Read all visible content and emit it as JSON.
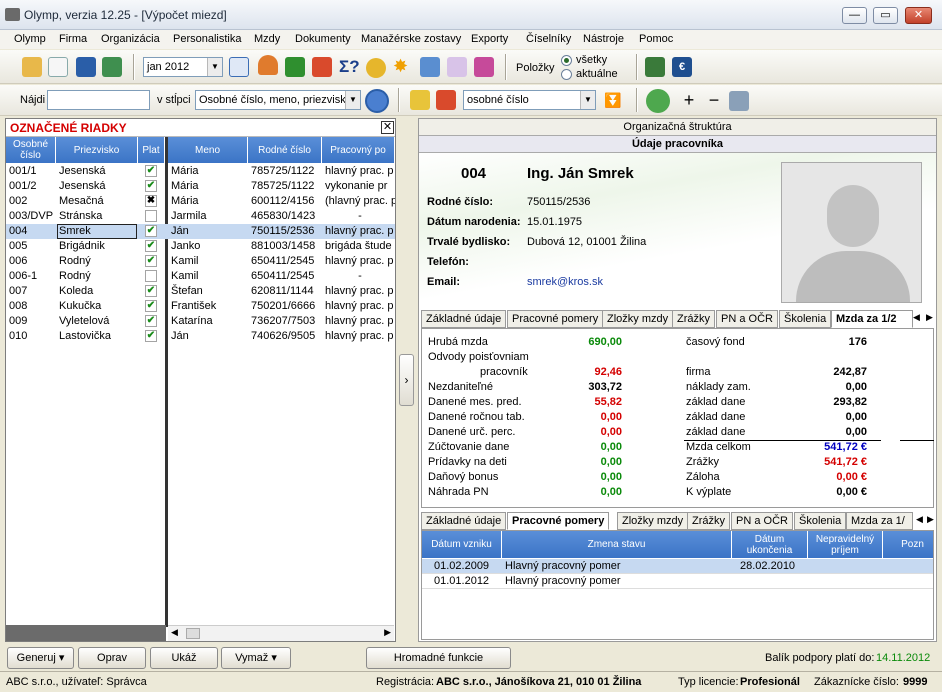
{
  "window": {
    "title": "Olymp, verzia 12.25 - [Výpočet miezd]"
  },
  "menu": [
    "Olymp",
    "Firma",
    "Organizácia",
    "Personalistika",
    "Mzdy",
    "Dokumenty",
    "Manažérske zostavy",
    "Exporty",
    "Číselníky",
    "Nástroje",
    "Pomoc"
  ],
  "toolbar": {
    "period": "jan 2012",
    "polozky_label": "Položky",
    "radio_all": "všetky",
    "radio_current": "aktuálne"
  },
  "search": {
    "label": "Nájdi",
    "in_column_label": "v stĺpci",
    "column_value": "Osobné číslo, meno, priezvisk",
    "sort_value": "osobné číslo"
  },
  "left": {
    "title": "OZNAČENÉ RIADKY",
    "headers": [
      "Osobné číslo",
      "Priezvisko",
      "Plat",
      "Meno",
      "Rodné číslo",
      "Pracovný po"
    ],
    "rows": [
      {
        "id": "001/1",
        "surname": "Jesenská",
        "chk": "✔",
        "name": "Mária",
        "rc": "785725/1122",
        "job": "hlavný prac. p"
      },
      {
        "id": "001/2",
        "surname": "Jesenská",
        "chk": "✔",
        "name": "Mária",
        "rc": "785725/1122",
        "job": "vykonanie pr"
      },
      {
        "id": "002",
        "surname": "Mesačná",
        "chk": "✖",
        "name": "Mária",
        "rc": "600112/4156",
        "job": "(hlavný prac. p"
      },
      {
        "id": "003/DVP",
        "surname": "Stránska",
        "chk": "",
        "name": "Jarmila",
        "rc": "465830/1423",
        "job": "-"
      },
      {
        "id": "004",
        "surname": "Smrek",
        "chk": "✔",
        "name": "Ján",
        "rc": "750115/2536",
        "job": "hlavný prac. p"
      },
      {
        "id": "005",
        "surname": "Brigádnik",
        "chk": "✔",
        "name": "Janko",
        "rc": "881003/1458",
        "job": "brigáda štude"
      },
      {
        "id": "006",
        "surname": "Rodný",
        "chk": "✔",
        "name": "Kamil",
        "rc": "650411/2545",
        "job": "hlavný prac. p"
      },
      {
        "id": "006-1",
        "surname": "Rodný",
        "chk": "",
        "name": "Kamil",
        "rc": "650411/2545",
        "job": "-"
      },
      {
        "id": "007",
        "surname": "Koleda",
        "chk": "✔",
        "name": "Štefan",
        "rc": "620811/1144",
        "job": "hlavný prac. p"
      },
      {
        "id": "008",
        "surname": "Kukučka",
        "chk": "✔",
        "name": "František",
        "rc": "750201/6666",
        "job": "hlavný prac. p"
      },
      {
        "id": "009",
        "surname": "Vyletelová",
        "chk": "✔",
        "name": "Katarína",
        "rc": "736207/7503",
        "job": "hlavný prac. p"
      },
      {
        "id": "010",
        "surname": "Lastovička",
        "chk": "✔",
        "name": "Ján",
        "rc": "740626/9505",
        "job": "hlavný prac. p"
      }
    ]
  },
  "right": {
    "org_header": "Organizačná štruktúra",
    "worker_header": "Údaje pracovníka",
    "emp_no": "004",
    "emp_name": "Ing. Ján Smrek",
    "fields": [
      {
        "label": "Rodné číslo:",
        "value": "750115/2536"
      },
      {
        "label": "Dátum narodenia:",
        "value": "15.01.1975"
      },
      {
        "label": "Trvalé bydlisko:",
        "value": "Dubová 12, 01001 Žilina"
      },
      {
        "label": "Telefón:",
        "value": ""
      },
      {
        "label": "Email:",
        "value": "smrek@kros.sk"
      }
    ],
    "tabs1": [
      "Základné údaje",
      "Pracovné pomery",
      "Zložky mzdy",
      "Zrážky",
      "PN a OČR",
      "Školenia",
      "Mzda za 1/2"
    ],
    "salary_left": [
      {
        "label": "Hrubá mzda",
        "value": "690,00",
        "color": "green"
      },
      {
        "label": "Odvody poisťovniam",
        "value": "",
        "color": ""
      },
      {
        "label": "pracovník",
        "value": "92,46",
        "color": "red"
      },
      {
        "label": "Nezdaniteľné",
        "value": "303,72",
        "color": ""
      },
      {
        "label": "Danené mes. pred.",
        "value": "55,82",
        "color": "red"
      },
      {
        "label": "Danené ročnou tab.",
        "value": "0,00",
        "color": "red"
      },
      {
        "label": "Danené urč. perc.",
        "value": "0,00",
        "color": "red"
      },
      {
        "label": "Zúčtovanie dane",
        "value": "0,00",
        "color": "green"
      },
      {
        "label": "Prídavky na deti",
        "value": "0,00",
        "color": "green"
      },
      {
        "label": "Daňový bonus",
        "value": "0,00",
        "color": "green"
      },
      {
        "label": "Náhrada PN",
        "value": "0,00",
        "color": "green"
      }
    ],
    "salary_right": [
      {
        "label": "časový fond",
        "value": "176",
        "color": ""
      },
      {
        "label": "",
        "value": "",
        "color": ""
      },
      {
        "label": "firma",
        "value": "242,87",
        "color": ""
      },
      {
        "label": "náklady zam.",
        "value": "0,00",
        "color": ""
      },
      {
        "label": "základ dane",
        "value": "293,82",
        "color": ""
      },
      {
        "label": "základ dane",
        "value": "0,00",
        "color": ""
      },
      {
        "label": "základ dane",
        "value": "0,00",
        "color": ""
      },
      {
        "label": "Mzda celkom",
        "value": "541,72 €",
        "color": "blue"
      },
      {
        "label": "Zrážky",
        "value": "541,72 €",
        "color": "red"
      },
      {
        "label": "Záloha",
        "value": "0,00 €",
        "color": "red"
      },
      {
        "label": "K výplate",
        "value": "0,00 €",
        "color": ""
      }
    ],
    "tabs2": [
      "Základné údaje",
      "Pracovné pomery",
      "Zložky mzdy",
      "Zrážky",
      "PN a OČR",
      "Školenia",
      "Mzda za 1/"
    ],
    "pomery_headers": [
      "Dátum vzniku",
      "Zmena stavu",
      "Dátum ukončenia",
      "Nepravidelný príjem",
      "Pozn"
    ],
    "pomery_rows": [
      {
        "start": "01.02.2009",
        "change": "Hlavný pracovný pomer",
        "end": "28.02.2010"
      },
      {
        "start": "01.01.2012",
        "change": "Hlavný pracovný pomer",
        "end": ""
      }
    ]
  },
  "bottom": {
    "generuj": "Generuj",
    "oprav": "Oprav",
    "ukaz": "Ukáž",
    "vymaz": "Vymaž",
    "hromadne": "Hromadné funkcie",
    "support_label": "Balík podpory platí do:",
    "support_date": "14.11.2012"
  },
  "status": {
    "company_user": "ABC s.r.o., užívateľ: Správca",
    "reg_label": "Registrácia:",
    "reg_value": "ABC s.r.o., Jánošíkova 21, 010 01 Žilina",
    "lic_label": "Typ licencie:",
    "lic_value": "Profesionál",
    "cust_label": "Zákaznícke číslo:",
    "cust_value": "9999"
  }
}
